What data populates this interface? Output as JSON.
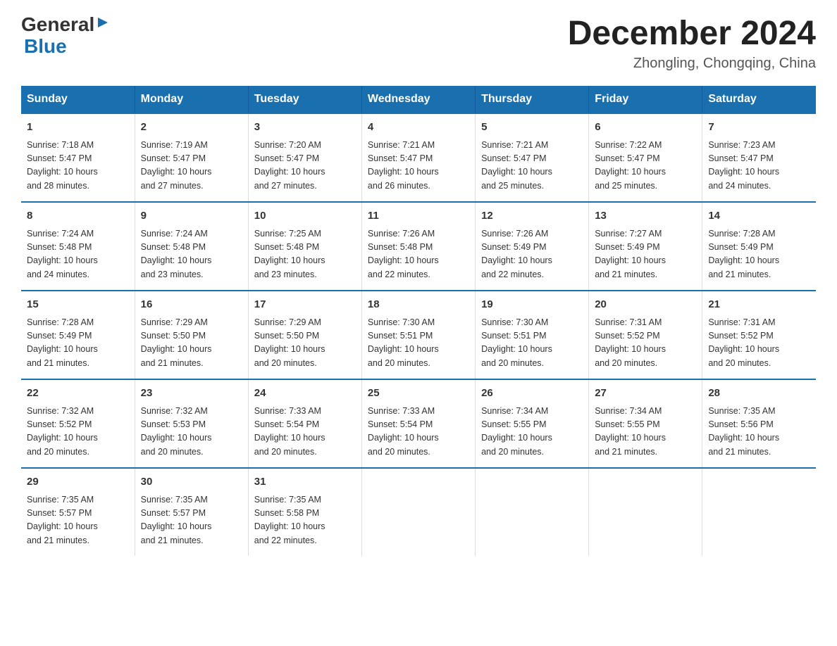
{
  "logo": {
    "text_general": "General",
    "text_blue": "Blue"
  },
  "title": {
    "month_year": "December 2024",
    "location": "Zhongling, Chongqing, China"
  },
  "days_of_week": [
    "Sunday",
    "Monday",
    "Tuesday",
    "Wednesday",
    "Thursday",
    "Friday",
    "Saturday"
  ],
  "weeks": [
    [
      {
        "day": "1",
        "sunrise": "7:18 AM",
        "sunset": "5:47 PM",
        "daylight": "10 hours and 28 minutes."
      },
      {
        "day": "2",
        "sunrise": "7:19 AM",
        "sunset": "5:47 PM",
        "daylight": "10 hours and 27 minutes."
      },
      {
        "day": "3",
        "sunrise": "7:20 AM",
        "sunset": "5:47 PM",
        "daylight": "10 hours and 27 minutes."
      },
      {
        "day": "4",
        "sunrise": "7:21 AM",
        "sunset": "5:47 PM",
        "daylight": "10 hours and 26 minutes."
      },
      {
        "day": "5",
        "sunrise": "7:21 AM",
        "sunset": "5:47 PM",
        "daylight": "10 hours and 25 minutes."
      },
      {
        "day": "6",
        "sunrise": "7:22 AM",
        "sunset": "5:47 PM",
        "daylight": "10 hours and 25 minutes."
      },
      {
        "day": "7",
        "sunrise": "7:23 AM",
        "sunset": "5:47 PM",
        "daylight": "10 hours and 24 minutes."
      }
    ],
    [
      {
        "day": "8",
        "sunrise": "7:24 AM",
        "sunset": "5:48 PM",
        "daylight": "10 hours and 24 minutes."
      },
      {
        "day": "9",
        "sunrise": "7:24 AM",
        "sunset": "5:48 PM",
        "daylight": "10 hours and 23 minutes."
      },
      {
        "day": "10",
        "sunrise": "7:25 AM",
        "sunset": "5:48 PM",
        "daylight": "10 hours and 23 minutes."
      },
      {
        "day": "11",
        "sunrise": "7:26 AM",
        "sunset": "5:48 PM",
        "daylight": "10 hours and 22 minutes."
      },
      {
        "day": "12",
        "sunrise": "7:26 AM",
        "sunset": "5:49 PM",
        "daylight": "10 hours and 22 minutes."
      },
      {
        "day": "13",
        "sunrise": "7:27 AM",
        "sunset": "5:49 PM",
        "daylight": "10 hours and 21 minutes."
      },
      {
        "day": "14",
        "sunrise": "7:28 AM",
        "sunset": "5:49 PM",
        "daylight": "10 hours and 21 minutes."
      }
    ],
    [
      {
        "day": "15",
        "sunrise": "7:28 AM",
        "sunset": "5:49 PM",
        "daylight": "10 hours and 21 minutes."
      },
      {
        "day": "16",
        "sunrise": "7:29 AM",
        "sunset": "5:50 PM",
        "daylight": "10 hours and 21 minutes."
      },
      {
        "day": "17",
        "sunrise": "7:29 AM",
        "sunset": "5:50 PM",
        "daylight": "10 hours and 20 minutes."
      },
      {
        "day": "18",
        "sunrise": "7:30 AM",
        "sunset": "5:51 PM",
        "daylight": "10 hours and 20 minutes."
      },
      {
        "day": "19",
        "sunrise": "7:30 AM",
        "sunset": "5:51 PM",
        "daylight": "10 hours and 20 minutes."
      },
      {
        "day": "20",
        "sunrise": "7:31 AM",
        "sunset": "5:52 PM",
        "daylight": "10 hours and 20 minutes."
      },
      {
        "day": "21",
        "sunrise": "7:31 AM",
        "sunset": "5:52 PM",
        "daylight": "10 hours and 20 minutes."
      }
    ],
    [
      {
        "day": "22",
        "sunrise": "7:32 AM",
        "sunset": "5:52 PM",
        "daylight": "10 hours and 20 minutes."
      },
      {
        "day": "23",
        "sunrise": "7:32 AM",
        "sunset": "5:53 PM",
        "daylight": "10 hours and 20 minutes."
      },
      {
        "day": "24",
        "sunrise": "7:33 AM",
        "sunset": "5:54 PM",
        "daylight": "10 hours and 20 minutes."
      },
      {
        "day": "25",
        "sunrise": "7:33 AM",
        "sunset": "5:54 PM",
        "daylight": "10 hours and 20 minutes."
      },
      {
        "day": "26",
        "sunrise": "7:34 AM",
        "sunset": "5:55 PM",
        "daylight": "10 hours and 20 minutes."
      },
      {
        "day": "27",
        "sunrise": "7:34 AM",
        "sunset": "5:55 PM",
        "daylight": "10 hours and 21 minutes."
      },
      {
        "day": "28",
        "sunrise": "7:35 AM",
        "sunset": "5:56 PM",
        "daylight": "10 hours and 21 minutes."
      }
    ],
    [
      {
        "day": "29",
        "sunrise": "7:35 AM",
        "sunset": "5:57 PM",
        "daylight": "10 hours and 21 minutes."
      },
      {
        "day": "30",
        "sunrise": "7:35 AM",
        "sunset": "5:57 PM",
        "daylight": "10 hours and 21 minutes."
      },
      {
        "day": "31",
        "sunrise": "7:35 AM",
        "sunset": "5:58 PM",
        "daylight": "10 hours and 22 minutes."
      },
      null,
      null,
      null,
      null
    ]
  ],
  "labels": {
    "sunrise": "Sunrise:",
    "sunset": "Sunset:",
    "daylight": "Daylight:"
  }
}
